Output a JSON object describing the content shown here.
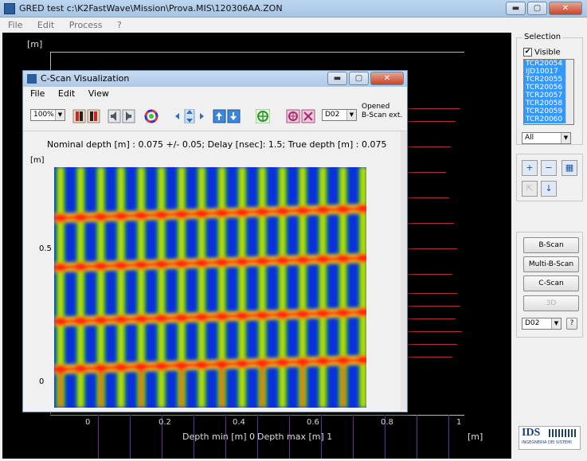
{
  "main": {
    "title": "GRED test c:\\K2FastWave\\Mission\\Prova.MIS\\120306AA.ZON",
    "menu": [
      "File",
      "Edit",
      "Process",
      "?"
    ],
    "window_buttons": {
      "minimize": "▬",
      "maximize": "▢",
      "close": "✕"
    }
  },
  "plot": {
    "y_unit": "[m]",
    "x_unit": "[m]",
    "x_ticks": [
      "0",
      "0.2",
      "0.4",
      "0.6",
      "0.8",
      "1"
    ],
    "depth_min_label": "Depth min [m] 0",
    "depth_max_label": "Depth max [m] 1"
  },
  "panel": {
    "selection_title": "Selection",
    "visible_label": "Visible",
    "visible_checked": "✔",
    "items": [
      "TCR20054",
      "IJD10017",
      "TCR20055",
      "TCR20056",
      "TCR20057",
      "TCR20058",
      "TCR20059",
      "TCR20060"
    ],
    "filter_value": "All",
    "bscan_button": "B-Scan",
    "multi_bscan_button": "Multi-B-Scan",
    "cscan_button": "C-Scan",
    "threed_button": "3D",
    "channel_value": "D02",
    "help_button": "?",
    "logo_text": "IDS",
    "logo_subtext": "INGEGNERIA DEI SISTEMI",
    "accent": "#3399ff"
  },
  "cscan": {
    "title": "C-Scan Visualization",
    "menu": [
      "File",
      "Edit",
      "View"
    ],
    "zoom_value": "100%",
    "channel_value": "D02",
    "opened_label": "Opened",
    "bscan_ext_label": "B-Scan ext.",
    "info": "Nominal depth [m] : 0.075 +/- 0.05;  Delay [nsec]: 1.5;  True depth [m] : 0.075",
    "y_unit": "[m]",
    "y_ticks": [
      "0.5",
      "0"
    ],
    "colors": {
      "background": "#0a2fe0",
      "ridge": "#ff2a10",
      "mid": "#27d100",
      "warm": "#f5e800"
    }
  }
}
